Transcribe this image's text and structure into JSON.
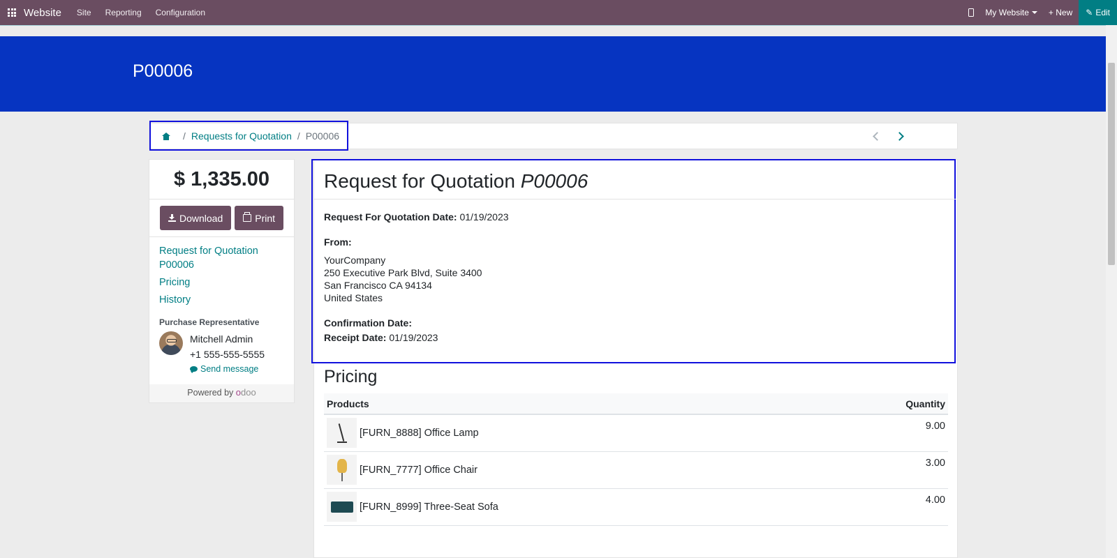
{
  "topbar": {
    "app_name": "Website",
    "menu": [
      "Site",
      "Reporting",
      "Configuration"
    ],
    "website_switch": "My Website",
    "new_label": "New",
    "edit_label": "Edit"
  },
  "banner": {
    "title": "P00006"
  },
  "breadcrumb": {
    "parent": "Requests for Quotation",
    "current": "P00006"
  },
  "sidebar": {
    "amount": "$ 1,335.00",
    "download_label": "Download",
    "print_label": "Print",
    "nav": [
      "Request for Quotation P00006",
      "Pricing",
      "History"
    ],
    "rep_title": "Purchase Representative",
    "rep_name": "Mitchell Admin",
    "rep_phone": "+1 555-555-5555",
    "send_message": "Send message",
    "powered_by": "Powered by",
    "odoo_o": "o",
    "odoo_rest": "doo"
  },
  "rfq": {
    "title_prefix": "Request for Quotation",
    "title_ref": "P00006",
    "date_label": "Request For Quotation Date:",
    "date_value": "01/19/2023",
    "from_label": "From:",
    "address": [
      "YourCompany",
      "250 Executive Park Blvd, Suite 3400",
      "San Francisco CA 94134",
      "United States"
    ],
    "confirmation_label": "Confirmation Date:",
    "receipt_label": "Receipt Date:",
    "receipt_value": "01/19/2023"
  },
  "pricing": {
    "title": "Pricing",
    "columns": [
      "Products",
      "Quantity"
    ],
    "rows": [
      {
        "name": "[FURN_8888] Office Lamp",
        "qty": "9.00",
        "icon": "lamp-image"
      },
      {
        "name": "[FURN_7777] Office Chair",
        "qty": "3.00",
        "icon": "chair-image"
      },
      {
        "name": "[FURN_8999] Three-Seat Sofa",
        "qty": "4.00",
        "icon": "sofa-image"
      }
    ]
  }
}
